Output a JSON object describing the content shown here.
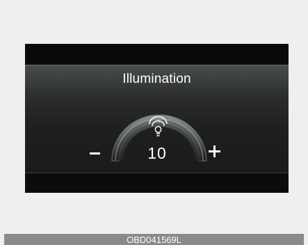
{
  "screen": {
    "title": "Illumination",
    "level": 10,
    "level_text": "10"
  },
  "controls": {
    "decrease_icon": "minus-icon",
    "increase_icon": "plus-icon",
    "indicator_icon": "illumination-icon"
  },
  "figure": {
    "code": "OBD041569L"
  },
  "colors": {
    "page_background": "#efefef",
    "display_background": "#0c0c0c",
    "panel_top": "#4a4d4e",
    "panel_bottom": "#1a1b1c",
    "gauge_frame": "#6c6f70",
    "gauge_segment": "#8d9091",
    "code_bar": "#8a8a8a",
    "text": "#ffffff"
  }
}
